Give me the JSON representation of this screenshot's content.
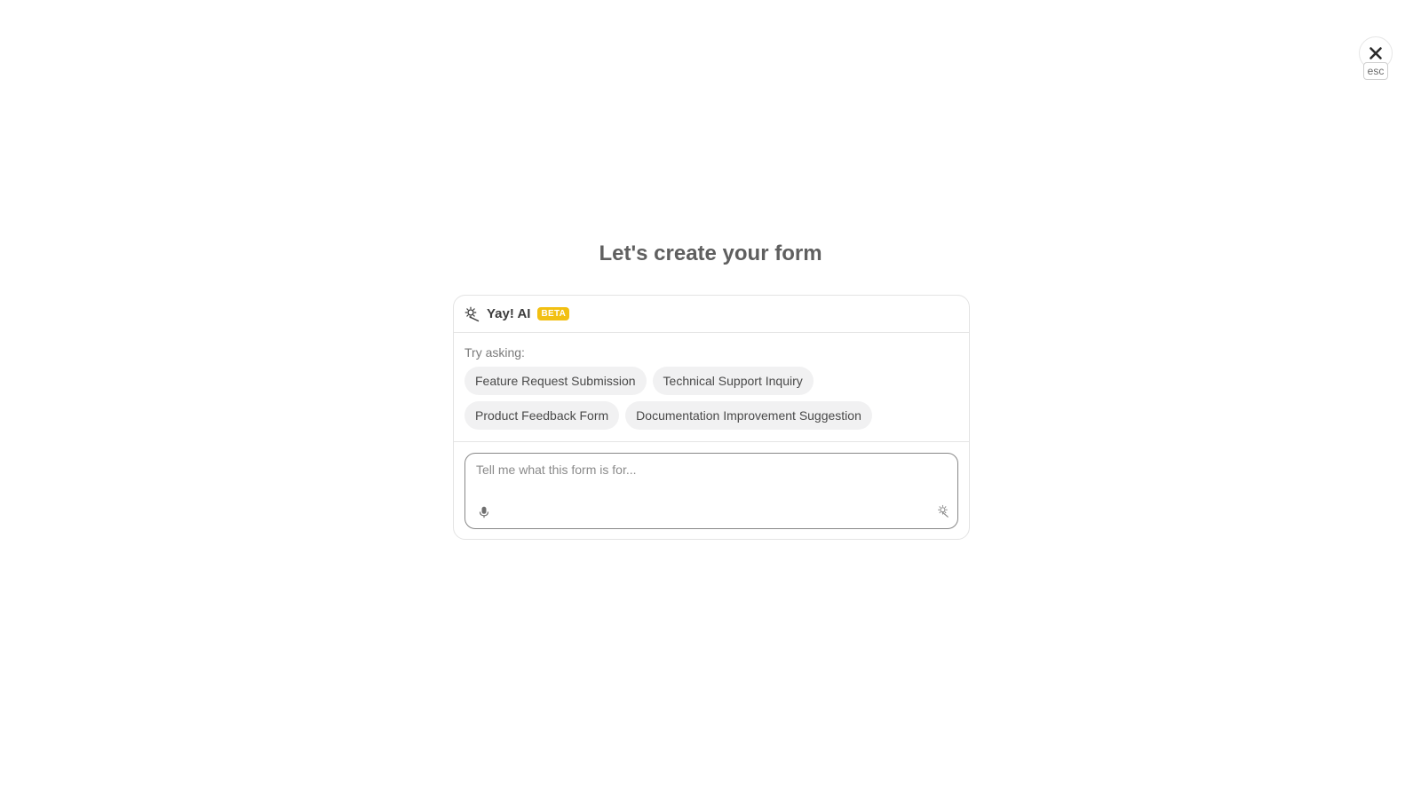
{
  "close": {
    "icon": "close-icon",
    "shortcut_label": "esc"
  },
  "page": {
    "title": "Let's create your form"
  },
  "assistant": {
    "icon": "magic-wand-icon",
    "name": "Yay! AI",
    "badge": "BETA",
    "badge_color": "#f2c012"
  },
  "suggestions": {
    "label": "Try asking:",
    "chips": [
      "Feature Request Submission",
      "Technical Support Inquiry",
      "Product Feedback Form",
      "Documentation Improvement Suggestion"
    ]
  },
  "prompt": {
    "placeholder": "Tell me what this form is for...",
    "value": "",
    "mic_icon": "microphone-icon",
    "submit_icon": "magic-wand-icon"
  }
}
